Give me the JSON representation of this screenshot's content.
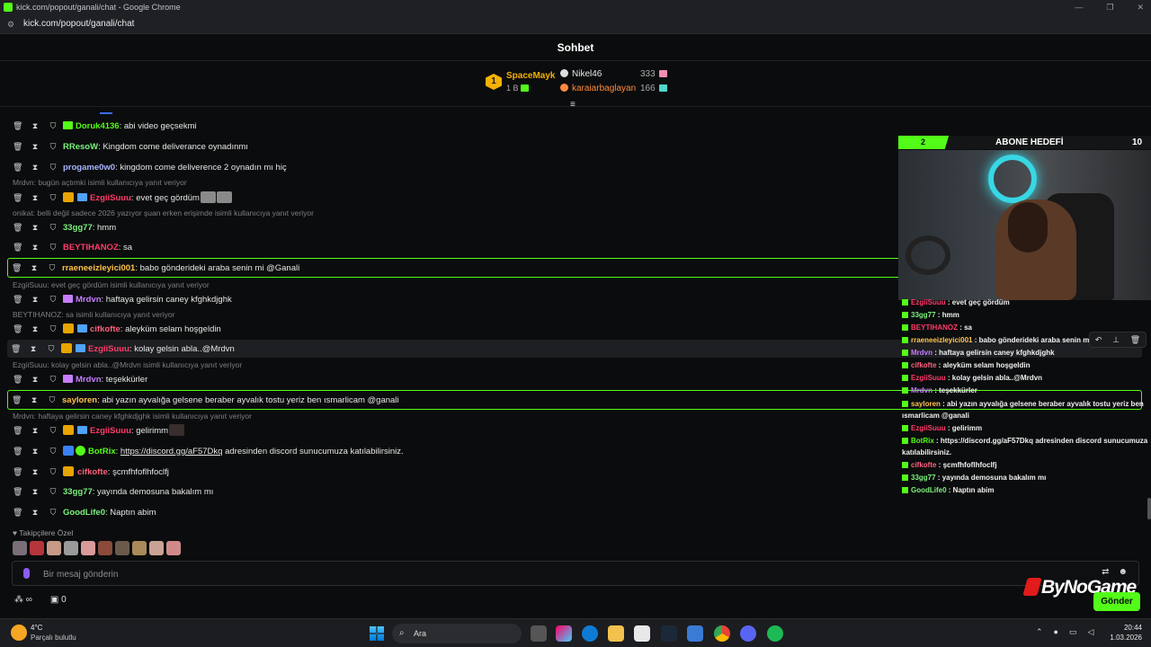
{
  "window": {
    "title": "kick.com/popout/ganali/chat - Google Chrome",
    "url": "kick.com/popout/ganali/chat"
  },
  "chat": {
    "header": "Sohbet",
    "leaderboard": {
      "top": {
        "rank": "1",
        "name": "SpaceMayk",
        "amount": "1 B"
      },
      "second": {
        "name": "Nikel46",
        "count": "333"
      },
      "third": {
        "name": "karaiarbaglayan",
        "count": "166"
      }
    },
    "messages": [
      {
        "user": "Doruk4136",
        "color": "#53fc18",
        "text": ": abi video geçsekmi"
      },
      {
        "user": "RResoW",
        "color": "#7cf27c",
        "text": ": Kingdom come deliverance oynadınmı"
      },
      {
        "user": "progame0w0",
        "color": "#a6b4ff",
        "text": ": kingdom come deliverence 2 oynadın mı hiç"
      },
      {
        "reply": "Mrdvn: bugün açtımki isimli kullanıcıya yanıt veriyor"
      },
      {
        "user": "EzgiiSuuu",
        "color": "#ff3b6b",
        "text": ": evet geç gördüm"
      },
      {
        "reply": "onikat: belli değil sadece 2026 yazıyor şuan erken erişimde isimli kullanıcıya yanıt veriyor"
      },
      {
        "user": "33gg77",
        "color": "#7cf27c",
        "text": ": hmm"
      },
      {
        "user": "BEYTIHANOZ",
        "color": "#ff3b6b",
        "text": ": sa"
      },
      {
        "user": "rraeneeizleyici001",
        "color": "#ffc24b",
        "text": ": babo gönderideki araba senin mi @Ganali"
      },
      {
        "reply": "EzgiiSuuu: evet geç gördüm isimli kullanıcıya yanıt veriyor"
      },
      {
        "user": "Mrdvn",
        "color": "#c77dff",
        "text": ": haftaya gelirsin caney kfghkdjghk"
      },
      {
        "reply": "BEYTIHANOZ: sa isimli kullanıcıya yanıt veriyor"
      },
      {
        "user": "cifkofte",
        "color": "#ff5f7e",
        "text": ": aleyküm selam hoşgeldin"
      },
      {
        "user": "EzgiiSuuu",
        "color": "#ff3b6b",
        "text": ": kolay gelsin abla..@Mrdvn"
      },
      {
        "reply": "EzgiiSuuu: kolay gelsin abla..@Mrdvn isimli kullanıcıya yanıt veriyor"
      },
      {
        "user": "Mrdvn",
        "color": "#c77dff",
        "text": ": teşekkürler"
      },
      {
        "user": "sayloren",
        "color": "#ffc24b",
        "text": ": abi yazın ayvalığa gelsene beraber ayvalık tostu yeriz ben ısmarlicam @ganali"
      },
      {
        "reply": "Mrdvn: haftaya gelirsin caney kfghkdjghk isimli kullanıcıya yanıt veriyor"
      },
      {
        "user": "EzgiiSuuu",
        "color": "#ff3b6b",
        "text": ": gelirimm"
      },
      {
        "user": "BotRix",
        "color": "#53fc18",
        "text": ": ",
        "link": "https://discord.gg/aF57Dkq",
        "after": " adresinden discord sunucumuza katılabilirsiniz."
      },
      {
        "user": "cifkofte",
        "color": "#ff5f7e",
        "text": ": şcmfhfoflhfoclfj"
      },
      {
        "user": "33gg77",
        "color": "#7cf27c",
        "text": ": yayında demosuna bakalım mı"
      },
      {
        "user": "GoodLife0",
        "color": "#7cf27c",
        "text": ": Naptın abim"
      }
    ],
    "followers_only": "Takipçilere Özel",
    "input_placeholder": "Bir mesaj gönderin",
    "bottom_left": "∞",
    "bottom_count": "0",
    "send_label": "Gönder"
  },
  "overlay": {
    "goal_current": "2",
    "goal_title": "ABONE HEDEFİ",
    "goal_target": "10",
    "goal_progress": 0.2,
    "messages": [
      {
        "user": "EzgiiSuuu",
        "color": "#ff3b6b",
        "text": " : evet geç gördüm"
      },
      {
        "user": "33gg77",
        "color": "#7cf27c",
        "text": " : hmm"
      },
      {
        "user": "BEYTIHANOZ",
        "color": "#ff3b6b",
        "text": " : sa"
      },
      {
        "user": "rraeneeizleyici001",
        "color": "#ffc24b",
        "text": " : babo gönderideki araba senin mi @Ganali"
      },
      {
        "user": "Mrdvn",
        "color": "#c77dff",
        "text": " : haftaya gelirsin caney kfghkdjghk"
      },
      {
        "user": "cifkofte",
        "color": "#ff5f7e",
        "text": " : aleyküm selam hoşgeldin"
      },
      {
        "user": "EzgiiSuuu",
        "color": "#ff3b6b",
        "text": " : kolay gelsin abla..@Mrdvn"
      },
      {
        "user": "Mrdvn",
        "color": "#c77dff",
        "text": " : teşekkürler"
      },
      {
        "user": "sayloren",
        "color": "#ffc24b",
        "text": " : abi yazın ayvalığa gelsene beraber ayvalık tostu yeriz ben ısmarlicam @ganali"
      },
      {
        "user": "EzgiiSuuu",
        "color": "#ff3b6b",
        "text": " : gelirimm"
      },
      {
        "user": "BotRix",
        "color": "#53fc18",
        "text": " : https://discord.gg/aF57Dkq adresinden discord sunucumuza katılabilirsiniz."
      },
      {
        "user": "cifkofte",
        "color": "#ff5f7e",
        "text": " : şcmfhfoflhfoclfj"
      },
      {
        "user": "33gg77",
        "color": "#7cf27c",
        "text": " : yayında demosuna bakalım mı"
      },
      {
        "user": "GoodLife0",
        "color": "#7cf27c",
        "text": " : Naptın abim"
      }
    ],
    "brand": "ByNoGame"
  },
  "taskbar": {
    "temp": "4°C",
    "weather": "Parçalı bulutlu",
    "search_placeholder": "Ara",
    "time": "20:44",
    "date": "1.03.2026"
  }
}
